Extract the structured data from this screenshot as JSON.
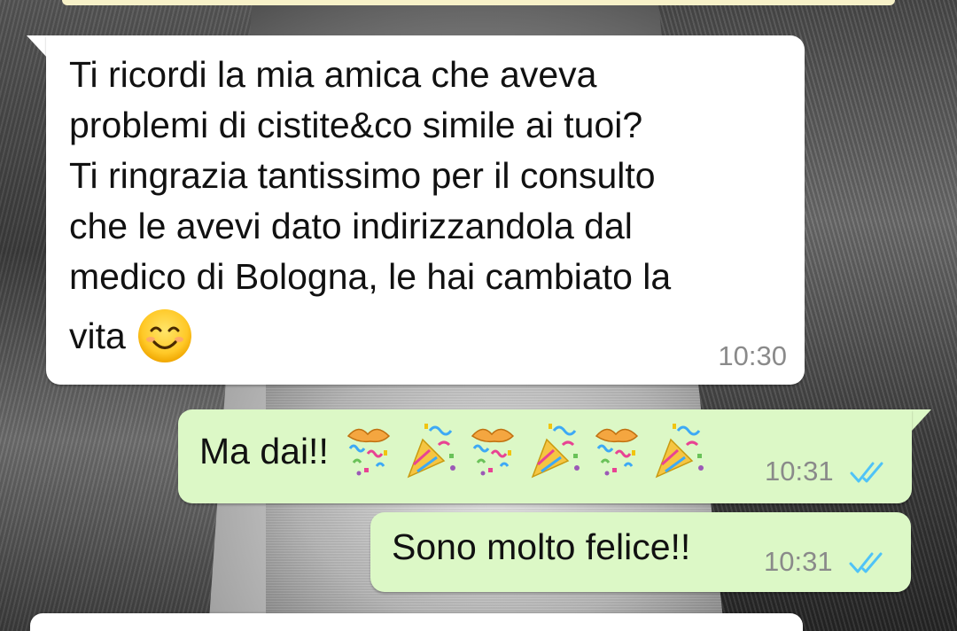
{
  "incoming_message": {
    "lines": [
      "Ti ricordi la mia amica che aveva",
      "problemi di cistite&co simile ai tuoi?",
      "Ti ringrazia tantissimo per il consulto",
      "che le avevi dato indirizzandola dal",
      "medico di Bologna, le hai cambiato la",
      "vita"
    ],
    "emoji": "smiling-face-icon",
    "time": "10:30"
  },
  "outgoing_messages": [
    {
      "text": "Ma dai!!",
      "emojis": [
        "confetti-ball-icon",
        "party-popper-icon",
        "confetti-ball-icon",
        "party-popper-icon",
        "confetti-ball-icon",
        "party-popper-icon"
      ],
      "time": "10:31",
      "status": "read-double-check-icon"
    },
    {
      "text": "Sono molto felice!!",
      "time": "10:31",
      "status": "read-double-check-icon"
    }
  ],
  "colors": {
    "incoming_bubble": "#ffffff",
    "outgoing_bubble": "#dcf8c6",
    "read_ticks": "#4fc3f7",
    "timestamp": "#8a8a8a"
  }
}
